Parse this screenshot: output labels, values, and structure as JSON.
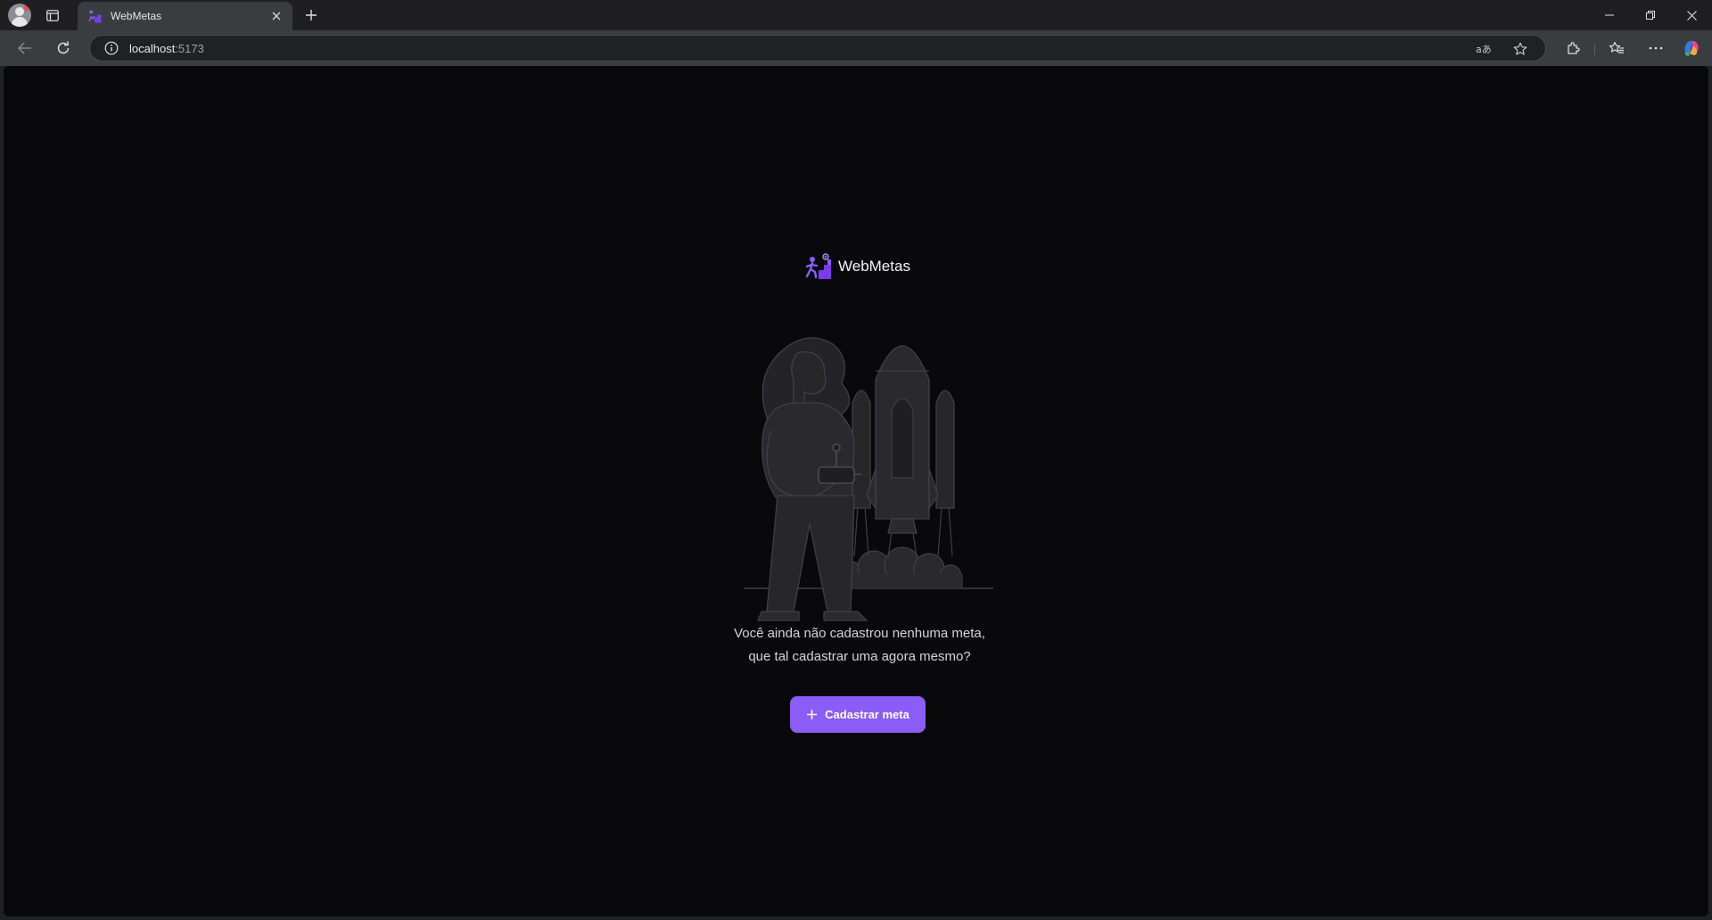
{
  "browser": {
    "tab": {
      "title": "WebMetas"
    },
    "address": {
      "host": "localhost",
      "port": ":5173"
    },
    "icons": [
      "profile-icon",
      "tab-actions-icon",
      "close-icon",
      "new-tab-icon",
      "minimize-icon",
      "restore-icon",
      "window-close-icon",
      "back-icon",
      "reload-icon",
      "info-icon",
      "read-aloud-icon",
      "favorite-star-icon",
      "extensions-icon",
      "favorites-icon",
      "more-icon",
      "copilot-icon"
    ]
  },
  "app": {
    "brand": {
      "name": "WebMetas"
    },
    "empty_state": {
      "line1": "Você ainda não cadastrou nenhuma meta,",
      "line2": "que tal cadastrar uma agora mesmo?"
    },
    "cta": {
      "label": "Cadastrar meta"
    },
    "colors": {
      "accent": "#8b5cf6",
      "background": "#09090b",
      "text": "#d4d4d8"
    }
  }
}
